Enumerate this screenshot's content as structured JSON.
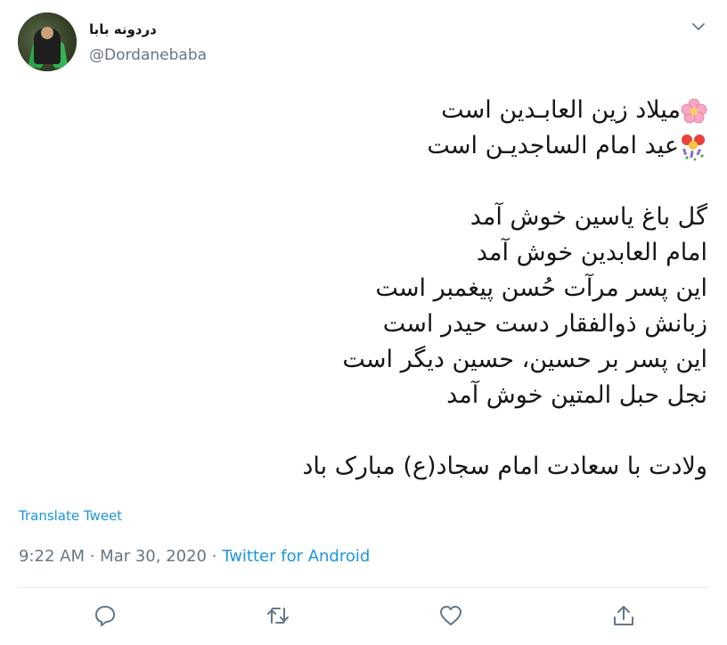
{
  "user": {
    "display_name": "دردونه بابا",
    "handle": "@Dordanebaba"
  },
  "tweet": {
    "lines": [
      "میلاد زین العابـدین است",
      "عید امام الساجدیـن است",
      "",
      "گل باغ یاسین خوش آمد",
      "امام العابدین خوش آمد",
      "این پسر مرآت حُسن پیغمبر است",
      "زبانش ذوالفقار دست حیدر است",
      "این پسر بر حسین، حسین دیگر است",
      "نجل حبل المتین خوش آمد",
      "",
      "ولادت با سعادت امام سجاد(ع) مبارک باد"
    ],
    "line1_emoji": "cherry-blossom-icon",
    "line2_emoji": "party-popper-icon"
  },
  "translate_label": "Translate Tweet",
  "meta": {
    "time": "9:22 AM",
    "sep1": " · ",
    "date": "Mar 30, 2020",
    "sep2": " · ",
    "source": "Twitter for Android"
  },
  "actions": [
    "reply-icon",
    "retweet-icon",
    "like-icon",
    "share-icon"
  ],
  "colors": {
    "text": "#14171a",
    "muted": "#657786",
    "link": "#1b95e0",
    "divider": "#e6ecf0"
  }
}
